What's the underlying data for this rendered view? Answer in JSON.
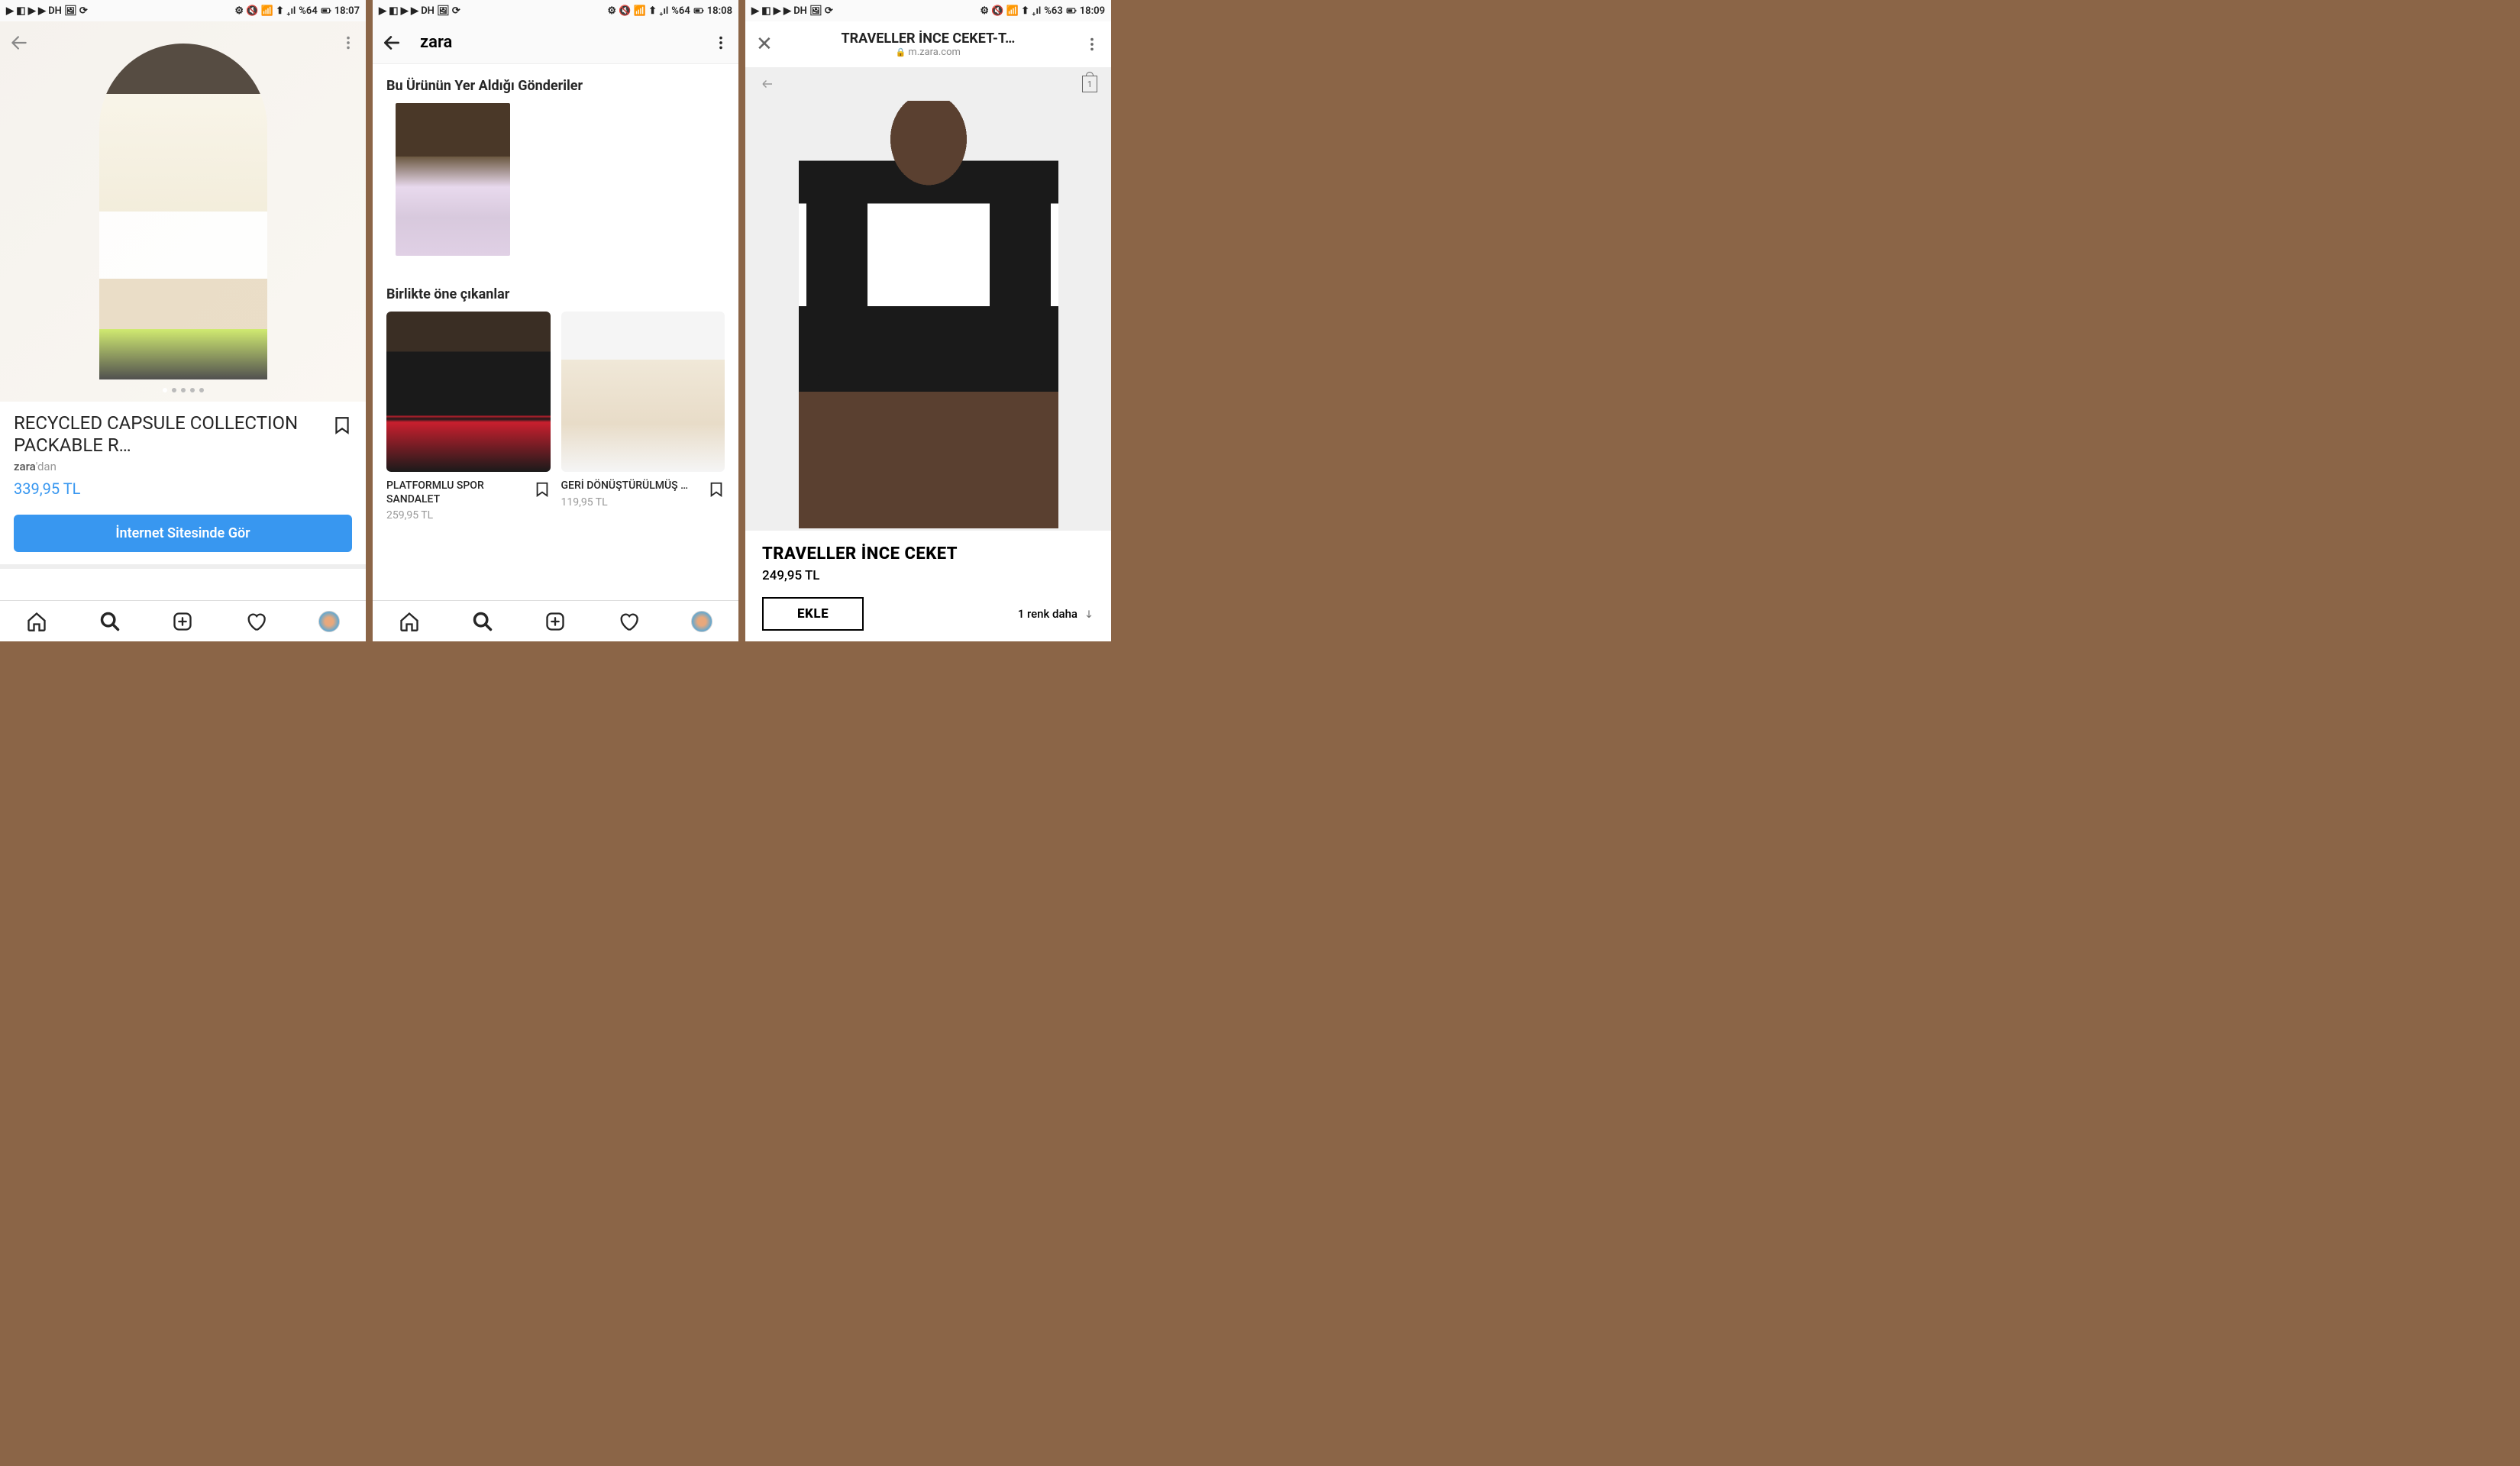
{
  "panel1": {
    "status": {
      "icons": "▶ ◧ ▶ ▶ DH 🖼 ⟳",
      "right": "⚙ 🔇 📶 ⬆ ₊ıl",
      "battery": "%64",
      "time": "18:07"
    },
    "product_title": "RECYCLED CAPSULE COLLECTION PACKABLE R…",
    "seller_prefix": "zara",
    "seller_suffix": "'dan",
    "price": "339,95 TL",
    "cta": "İnternet Sitesinde Gör"
  },
  "panel2": {
    "status": {
      "icons": "▶ ◧ ▶ ▶ DH 🖼 ⟳",
      "right": "⚙ 🔇 📶 ⬆ ₊ıl",
      "battery": "%64",
      "time": "18:08"
    },
    "header_title": "zara",
    "section_posts": "Bu Ürünün Yer Aldığı Gönderiler",
    "section_featured": "Birlikte öne çıkanlar",
    "products": [
      {
        "title": "PLATFORMLU SPOR SANDALET",
        "price": "259,95 TL"
      },
      {
        "title": "GERİ DÖNÜŞTÜRÜLMÜŞ …",
        "price": "119,95 TL"
      }
    ]
  },
  "panel3": {
    "status": {
      "icons": "▶ ◧ ▶ ▶ DH 🖼 ⟳",
      "right": "⚙ 🔇 📶 ⬆ ₊ıl",
      "battery": "%63",
      "time": "18:09"
    },
    "browser_title": "TRAVELLER İNCE CEKET-T…",
    "browser_url": "m.zara.com",
    "bag_count": "1",
    "product_title": "TRAVELLER İNCE CEKET",
    "price": "249,95 TL",
    "add_btn": "EKLE",
    "more_colors": "1 renk daha"
  }
}
